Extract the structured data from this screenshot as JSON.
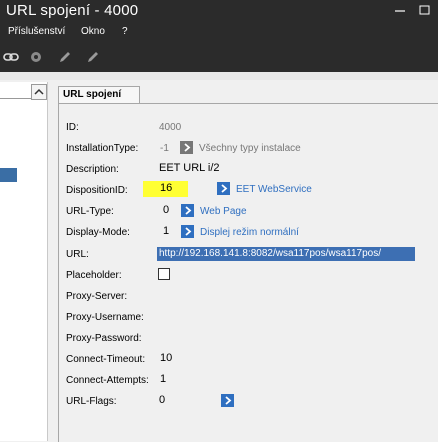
{
  "window": {
    "title": "URL spojení - 4000"
  },
  "menu": {
    "items": [
      "Příslušenství",
      "Okno",
      "?"
    ]
  },
  "tab": {
    "label": "URL spojení"
  },
  "form": {
    "rows": [
      {
        "label": "ID:",
        "value": "4000"
      },
      {
        "label": "InstallationType:",
        "value": "-1",
        "link": "Všechny typy instalace"
      },
      {
        "label": "Description:",
        "value": "EET URL i/2"
      },
      {
        "label": "DispositionID:",
        "value": "16",
        "link": "EET WebService"
      },
      {
        "label": "URL-Type:",
        "value": "0",
        "link": "Web Page"
      },
      {
        "label": "Display-Mode:",
        "value": "1",
        "link": "Displej režim normální"
      },
      {
        "label": "URL:",
        "value": "http://192.168.141.8:8082/wsa117pos/wsa117pos/"
      },
      {
        "label": "Placeholder:",
        "value": ""
      },
      {
        "label": "Proxy-Server:",
        "value": ""
      },
      {
        "label": "Proxy-Username:",
        "value": ""
      },
      {
        "label": "Proxy-Password:",
        "value": ""
      },
      {
        "label": "Connect-Timeout:",
        "value": "10"
      },
      {
        "label": "Connect-Attempts:",
        "value": "1"
      },
      {
        "label": "URL-Flags:",
        "value": "0"
      }
    ]
  },
  "colors": {
    "titlebar": "#2b2b2b",
    "accent": "#2f6fc0",
    "highlight": "#ffff33",
    "selection": "#3d6fb3"
  }
}
